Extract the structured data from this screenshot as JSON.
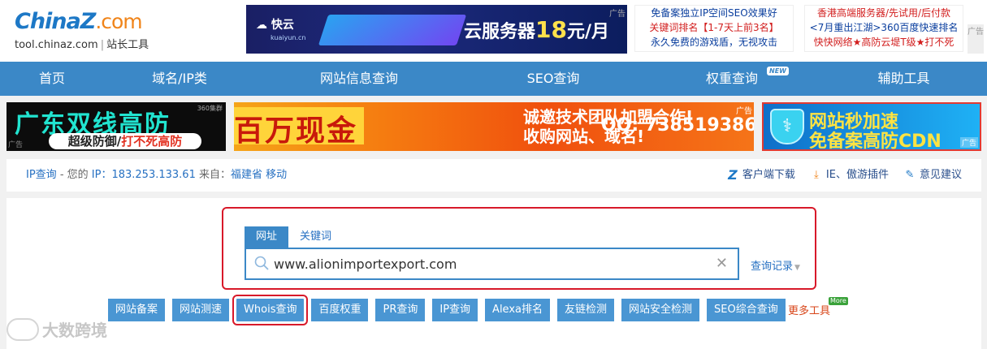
{
  "header": {
    "logo_main_a": "China",
    "logo_main_z": "Z",
    "logo_main_com": ".com",
    "logo_domain": "tool.chinaz.com",
    "logo_sep": "|",
    "logo_tagline": "站长工具",
    "top_banner": {
      "brand": "快云",
      "brand_sub": "kuaiyun.cn",
      "text_prefix": "云服务器",
      "price": "18",
      "text_suffix": "元/月",
      "tag": "广告"
    },
    "text_ad_1": {
      "line1": "免备案独立IP空间SEO效果好",
      "line2": "关键词排名【1-7天上前3名】",
      "line3": "永久免费的游戏盾，无视攻击"
    },
    "text_ad_2": {
      "line1": "香港高端服务器/先试用/后付款",
      "line2": "<7月重出江湖>360百度快速排名",
      "line3": "快快网络★高防云堤T级★打不死"
    },
    "side_tag": "广告"
  },
  "nav": {
    "items": [
      {
        "label": "首页"
      },
      {
        "label": "域名/IP类"
      },
      {
        "label": "网站信息查询"
      },
      {
        "label": "SEO查询"
      },
      {
        "label": "权重查询",
        "badge": "NEW"
      },
      {
        "label": "辅助工具"
      }
    ]
  },
  "ads_row": {
    "ad_a": {
      "title": "广东双线高防",
      "sub_a": "超级防御/",
      "sub_b": "打不死高防",
      "corner": "360集群",
      "tag": "广告"
    },
    "ad_b": {
      "money": "百万现金",
      "recruit_1": "诚邀技术团队加盟合作!",
      "recruit_2": "收购网站、域名!",
      "qq": "QQ: 738519386",
      "tag": "广告"
    },
    "ad_c": {
      "line1": "网站秒加速",
      "line2": "免备案高防CDN",
      "tag": "广告"
    }
  },
  "ipbar": {
    "link": "IP查询",
    "label_mine": " - 您的 ",
    "label_ip": "IP：",
    "ip": "183.253.133.61",
    "label_from": " 来自：",
    "location": "福建省 移动",
    "client_download": "客户端下载",
    "plugin": "IE、傲游插件",
    "feedback": "意见建议"
  },
  "search": {
    "tabs": [
      "网址",
      "关键词"
    ],
    "value": "www.alionimportexport.com",
    "history": "查询记录"
  },
  "tools": {
    "buttons": [
      "网站备案",
      "网站测速",
      "Whois查询",
      "百度权重",
      "PR查询",
      "IP查询",
      "Alexa排名",
      "友链检测",
      "网站安全检测",
      "SEO综合查询"
    ],
    "more": "更多工具",
    "more_badge": "More"
  },
  "watermark": "大数跨境",
  "colors": {
    "nav": "#3b88c7",
    "button": "#4a96d3",
    "highlight": "#d8192a"
  }
}
